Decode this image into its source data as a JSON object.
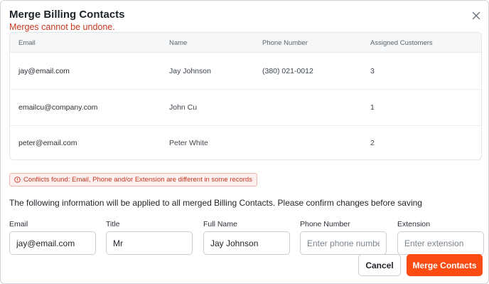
{
  "dialog": {
    "title": "Merge Billing Contacts",
    "warning": "Merges cannot be undone.",
    "close_icon": "close-icon"
  },
  "table": {
    "columns": [
      "Email",
      "Name",
      "Phone Number",
      "Assigned Customers"
    ],
    "rows": [
      {
        "email": "jay@email.com",
        "name": "Jay Johnson",
        "phone": "(380) 021-0012",
        "assigned": "3"
      },
      {
        "email": "emailcu@company.com",
        "name": "John Cu",
        "phone": "",
        "assigned": "1"
      },
      {
        "email": "peter@email.com",
        "name": "Peter White",
        "phone": "",
        "assigned": "2"
      }
    ]
  },
  "conflict": {
    "icon": "alert-circle-icon",
    "text": "Conflicts found: Email, Phone and/or Extension are different in some records"
  },
  "info_text": "The following information will be applied to all merged Billing Contacts. Please confirm changes before saving",
  "form": {
    "email": {
      "label": "Email",
      "value": "jay@email.com",
      "placeholder": ""
    },
    "title": {
      "label": "Title",
      "value": "Mr",
      "placeholder": ""
    },
    "full_name": {
      "label": "Full Name",
      "value": "Jay Johnson",
      "placeholder": ""
    },
    "phone": {
      "label": "Phone Number",
      "value": "",
      "placeholder": "Enter phone number"
    },
    "extension": {
      "label": "Extension",
      "value": "",
      "placeholder": "Enter extension"
    }
  },
  "buttons": {
    "cancel": "Cancel",
    "merge": "Merge Contacts"
  },
  "colors": {
    "accent": "#fc4c12",
    "danger": "#c8371f"
  }
}
